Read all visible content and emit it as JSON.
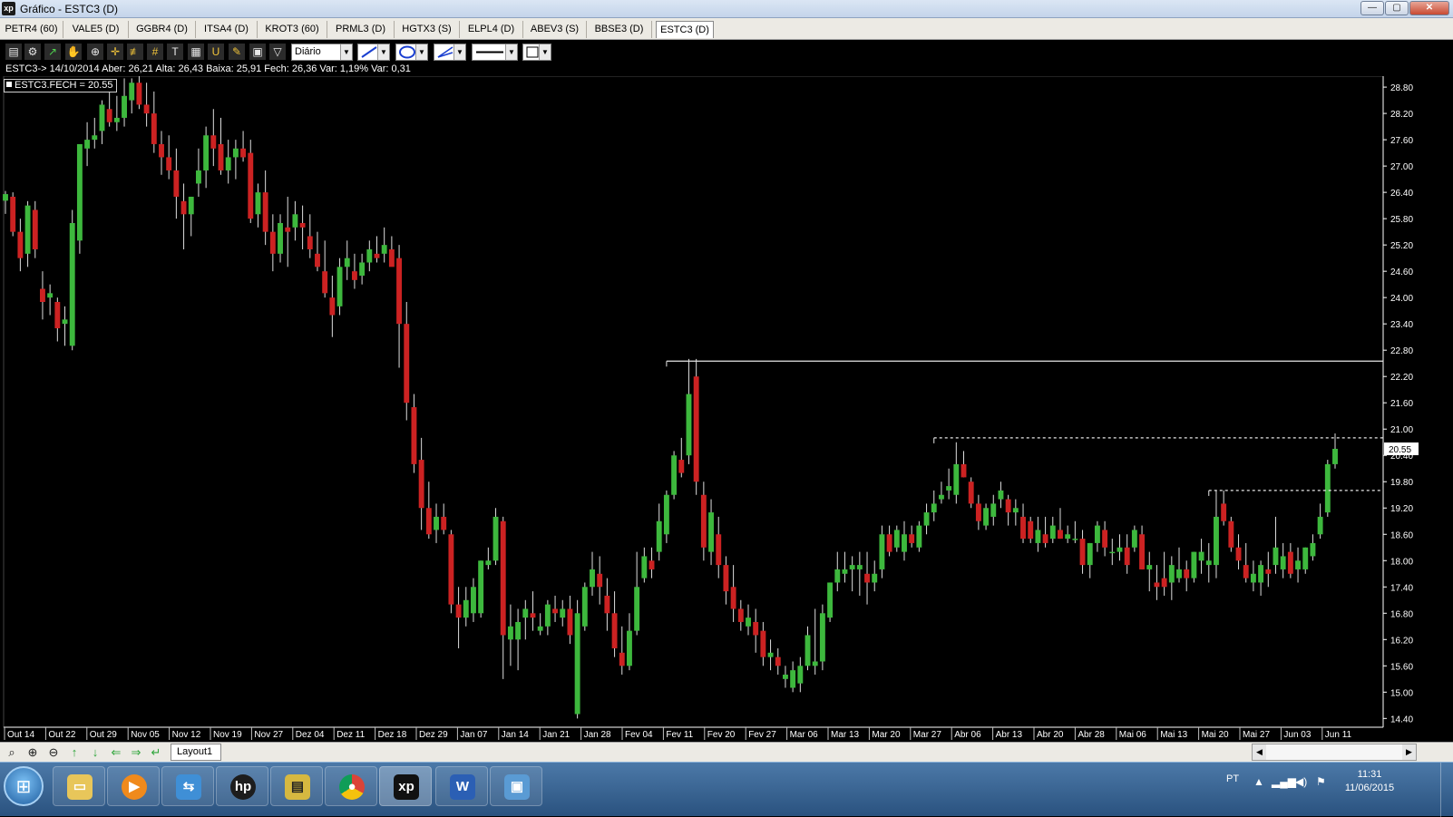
{
  "window": {
    "title": "Gráfico - ESTC3 (D)",
    "icon": "xp-logo-icon",
    "min_label": "—",
    "max_label": "▢",
    "close_label": "✕"
  },
  "tabs": [
    "PETR4 (60)",
    "VALE5 (D)",
    "GGBR4 (D)",
    "ITSA4 (D)",
    "KROT3 (60)",
    "PRML3 (D)",
    "HGTX3 (S)",
    "ELPL4 (D)",
    "ABEV3 (S)",
    "BBSE3 (D)",
    "ESTC3 (D)"
  ],
  "active_tab": "ESTC3 (D)",
  "toolbar": {
    "icons": [
      "chart-type-icon",
      "gear-icon",
      "trend-icon",
      "hand-icon",
      "zoom-chart-icon",
      "crosshair-icon",
      "fibonacci-icon",
      "grid-icon",
      "text-tool-icon",
      "calculator-icon",
      "magnet-icon",
      "eraser-icon",
      "lock-icon",
      "filter-icon"
    ],
    "period": "Diário",
    "line_tool": "line-tool-icon",
    "shape_tool": "ellipse-tool-icon",
    "channel_tool": "channel-tool-icon"
  },
  "info": {
    "line": "ESTC3-> 14/10/2014 Aber: 26,21 Alta: 26,43 Baixa: 25,91 Fech: 26,36 Var: 1,19% Var: 0,31",
    "legend": "ESTC3.FECH = 20.55"
  },
  "colors": {
    "up": "#3db83d",
    "down": "#cc2222",
    "wick": "#dddddd",
    "axis": "#ffffff",
    "background": "#000000"
  },
  "chart_data": {
    "type": "candlestick",
    "symbol": "ESTC3",
    "period": "Diário",
    "ylim": [
      14.2,
      29.05
    ],
    "y_ticks": [
      14.4,
      15.0,
      15.6,
      16.2,
      16.8,
      17.4,
      18.0,
      18.6,
      19.2,
      19.8,
      20.4,
      21.0,
      21.6,
      22.2,
      22.8,
      23.4,
      24.0,
      24.6,
      25.2,
      25.8,
      26.4,
      27.0,
      27.6,
      28.2,
      28.8
    ],
    "x_labels": [
      "Out 14",
      "Out 22",
      "Out 29",
      "Nov 05",
      "Nov 12",
      "Nov 19",
      "Nov 27",
      "Dez 04",
      "Dez 11",
      "Dez 18",
      "Dez 29",
      "Jan 07",
      "Jan 14",
      "Jan 21",
      "Jan 28",
      "Fev 04",
      "Fev 11",
      "Fev 20",
      "Fev 27",
      "Mar 06",
      "Mar 13",
      "Mar 20",
      "Mar 27",
      "Abr 06",
      "Abr 13",
      "Abr 20",
      "Abr 28",
      "Mai 06",
      "Mai 13",
      "Mai 20",
      "Mai 27",
      "Jun 03",
      "Jun 11"
    ],
    "last_price": 20.55,
    "ohlc": [
      [
        26.21,
        26.43,
        25.91,
        26.36
      ],
      [
        26.3,
        26.4,
        25.4,
        25.5
      ],
      [
        25.5,
        25.8,
        24.6,
        24.9
      ],
      [
        25.0,
        26.2,
        24.7,
        26.1
      ],
      [
        26.0,
        26.2,
        24.9,
        25.1
      ],
      [
        24.2,
        24.6,
        23.5,
        23.9
      ],
      [
        24.0,
        24.3,
        23.6,
        24.1
      ],
      [
        23.9,
        24.0,
        23.0,
        23.3
      ],
      [
        23.4,
        23.8,
        22.9,
        23.5
      ],
      [
        22.9,
        26.0,
        22.8,
        25.7
      ],
      [
        25.3,
        26.8,
        25.0,
        27.5
      ],
      [
        27.4,
        28.0,
        27.0,
        27.6
      ],
      [
        27.6,
        28.1,
        27.4,
        27.7
      ],
      [
        27.8,
        28.5,
        27.5,
        28.4
      ],
      [
        28.3,
        28.7,
        27.9,
        28.0
      ],
      [
        28.0,
        28.6,
        27.8,
        28.1
      ],
      [
        28.1,
        29.0,
        27.9,
        28.6
      ],
      [
        28.5,
        29.0,
        28.2,
        28.9
      ],
      [
        28.9,
        29.05,
        28.3,
        28.4
      ],
      [
        28.4,
        28.9,
        27.9,
        28.2
      ],
      [
        28.2,
        28.7,
        27.3,
        27.5
      ],
      [
        27.5,
        27.8,
        26.8,
        27.2
      ],
      [
        27.2,
        27.7,
        26.7,
        26.9
      ],
      [
        26.9,
        27.4,
        25.8,
        26.3
      ],
      [
        26.2,
        26.6,
        25.1,
        25.9
      ],
      [
        25.9,
        26.3,
        25.4,
        26.3
      ],
      [
        26.6,
        27.4,
        26.3,
        26.9
      ],
      [
        26.9,
        27.9,
        26.5,
        27.7
      ],
      [
        27.7,
        28.3,
        27.0,
        27.4
      ],
      [
        27.5,
        28.1,
        26.8,
        26.9
      ],
      [
        26.9,
        27.6,
        26.6,
        27.2
      ],
      [
        27.2,
        27.6,
        26.7,
        27.4
      ],
      [
        27.4,
        27.8,
        27.1,
        27.2
      ],
      [
        27.3,
        27.6,
        25.7,
        25.8
      ],
      [
        25.9,
        26.6,
        25.6,
        26.4
      ],
      [
        26.4,
        26.9,
        25.2,
        25.5
      ],
      [
        25.5,
        25.9,
        24.6,
        25.0
      ],
      [
        25.0,
        25.9,
        24.8,
        25.7
      ],
      [
        25.6,
        26.3,
        24.7,
        25.5
      ],
      [
        25.6,
        26.2,
        25.3,
        25.9
      ],
      [
        25.7,
        26.1,
        25.1,
        25.6
      ],
      [
        25.4,
        25.9,
        24.9,
        25.1
      ],
      [
        25.0,
        25.5,
        24.6,
        24.7
      ],
      [
        24.6,
        25.3,
        24.0,
        24.1
      ],
      [
        24.0,
        24.5,
        23.1,
        23.6
      ],
      [
        23.8,
        24.9,
        23.6,
        24.7
      ],
      [
        24.7,
        25.3,
        24.4,
        24.9
      ],
      [
        24.6,
        25.0,
        24.2,
        24.4
      ],
      [
        24.5,
        25.0,
        24.3,
        24.8
      ],
      [
        24.8,
        25.3,
        24.6,
        25.1
      ],
      [
        25.0,
        25.4,
        24.8,
        24.9
      ],
      [
        25.0,
        25.6,
        24.8,
        25.2
      ],
      [
        25.1,
        25.4,
        24.8,
        24.7
      ],
      [
        24.9,
        25.2,
        22.4,
        23.4
      ],
      [
        23.4,
        23.9,
        21.2,
        21.6
      ],
      [
        21.5,
        21.8,
        20.0,
        20.2
      ],
      [
        20.3,
        20.8,
        18.7,
        19.2
      ],
      [
        19.2,
        19.8,
        18.5,
        18.6
      ],
      [
        18.7,
        19.3,
        18.4,
        19.0
      ],
      [
        19.0,
        19.3,
        18.6,
        18.7
      ],
      [
        18.6,
        18.7,
        16.8,
        17.0
      ],
      [
        17.0,
        17.4,
        16.0,
        16.7
      ],
      [
        16.7,
        17.4,
        16.5,
        17.1
      ],
      [
        16.8,
        17.6,
        16.6,
        17.4
      ],
      [
        16.8,
        18.0,
        16.7,
        18.0
      ],
      [
        17.9,
        18.3,
        17.8,
        18.0
      ],
      [
        18.0,
        19.2,
        17.9,
        19.0
      ],
      [
        18.9,
        19.0,
        15.3,
        16.3
      ],
      [
        16.2,
        17.0,
        15.6,
        16.5
      ],
      [
        16.2,
        16.9,
        15.5,
        16.6
      ],
      [
        16.7,
        17.1,
        16.2,
        16.9
      ],
      [
        16.8,
        17.3,
        16.4,
        16.7
      ],
      [
        16.4,
        16.8,
        16.3,
        16.5
      ],
      [
        16.5,
        17.1,
        16.3,
        17.0
      ],
      [
        16.9,
        17.2,
        16.6,
        16.8
      ],
      [
        16.7,
        17.1,
        16.5,
        16.9
      ],
      [
        16.9,
        17.2,
        16.1,
        16.3
      ],
      [
        14.5,
        17.1,
        14.4,
        16.8
      ],
      [
        16.5,
        17.5,
        16.4,
        17.4
      ],
      [
        17.4,
        18.2,
        17.2,
        17.8
      ],
      [
        17.7,
        18.1,
        17.0,
        17.4
      ],
      [
        17.2,
        17.6,
        16.4,
        16.8
      ],
      [
        16.8,
        17.3,
        15.8,
        16.0
      ],
      [
        15.9,
        16.5,
        15.4,
        15.6
      ],
      [
        15.6,
        16.8,
        15.5,
        16.4
      ],
      [
        16.4,
        18.2,
        16.3,
        17.4
      ],
      [
        17.6,
        18.3,
        17.5,
        18.1
      ],
      [
        18.0,
        18.3,
        17.6,
        17.8
      ],
      [
        18.2,
        19.3,
        18.0,
        18.9
      ],
      [
        18.6,
        19.6,
        18.4,
        19.5
      ],
      [
        19.5,
        20.5,
        19.4,
        20.4
      ],
      [
        20.3,
        20.8,
        19.9,
        20.0
      ],
      [
        20.4,
        22.6,
        20.2,
        21.8
      ],
      [
        22.2,
        22.6,
        19.5,
        19.8
      ],
      [
        19.5,
        19.8,
        18.0,
        18.3
      ],
      [
        18.2,
        19.4,
        17.9,
        19.1
      ],
      [
        18.6,
        19.0,
        17.6,
        17.9
      ],
      [
        17.9,
        18.1,
        17.0,
        17.3
      ],
      [
        17.4,
        17.9,
        16.6,
        16.9
      ],
      [
        16.9,
        17.1,
        16.4,
        16.6
      ],
      [
        16.5,
        17.0,
        16.3,
        16.7
      ],
      [
        16.6,
        16.9,
        15.9,
        16.3
      ],
      [
        16.4,
        16.6,
        15.6,
        15.8
      ],
      [
        15.8,
        16.2,
        15.5,
        15.9
      ],
      [
        15.8,
        16.0,
        15.4,
        15.6
      ],
      [
        15.3,
        15.6,
        15.1,
        15.4
      ],
      [
        15.1,
        15.7,
        15.0,
        15.5
      ],
      [
        15.2,
        15.8,
        15.0,
        15.6
      ],
      [
        15.6,
        16.5,
        15.5,
        16.3
      ],
      [
        15.6,
        16.9,
        15.4,
        15.7
      ],
      [
        15.7,
        17.0,
        15.5,
        16.8
      ],
      [
        16.7,
        17.5,
        16.6,
        17.5
      ],
      [
        17.5,
        18.2,
        17.3,
        17.8
      ],
      [
        17.7,
        18.2,
        17.5,
        17.8
      ],
      [
        17.8,
        18.1,
        17.3,
        17.9
      ],
      [
        17.8,
        18.2,
        17.2,
        17.9
      ],
      [
        17.7,
        18.2,
        17.0,
        17.5
      ],
      [
        17.5,
        18.0,
        17.3,
        17.7
      ],
      [
        17.8,
        18.8,
        17.6,
        18.6
      ],
      [
        18.6,
        18.8,
        18.1,
        18.2
      ],
      [
        18.3,
        18.8,
        18.2,
        18.7
      ],
      [
        18.2,
        18.9,
        18.0,
        18.6
      ],
      [
        18.6,
        18.8,
        18.3,
        18.4
      ],
      [
        18.3,
        18.9,
        18.2,
        18.8
      ],
      [
        18.8,
        19.3,
        18.6,
        19.1
      ],
      [
        19.1,
        19.6,
        18.9,
        19.3
      ],
      [
        19.4,
        19.8,
        19.3,
        19.5
      ],
      [
        19.6,
        20.1,
        19.4,
        19.7
      ],
      [
        19.5,
        20.7,
        19.3,
        20.2
      ],
      [
        20.2,
        20.5,
        19.9,
        19.9
      ],
      [
        19.8,
        19.9,
        19.2,
        19.3
      ],
      [
        19.3,
        19.5,
        18.7,
        18.9
      ],
      [
        18.8,
        19.3,
        18.7,
        19.2
      ],
      [
        19.0,
        19.5,
        18.8,
        19.3
      ],
      [
        19.4,
        19.8,
        19.2,
        19.6
      ],
      [
        19.4,
        19.5,
        18.8,
        19.1
      ],
      [
        19.1,
        19.4,
        18.8,
        19.2
      ],
      [
        19.0,
        19.3,
        18.4,
        18.5
      ],
      [
        18.9,
        19.0,
        18.4,
        18.5
      ],
      [
        18.4,
        19.0,
        18.2,
        18.7
      ],
      [
        18.6,
        19.0,
        18.3,
        18.4
      ],
      [
        18.5,
        19.0,
        18.4,
        18.8
      ],
      [
        18.7,
        19.2,
        18.5,
        18.5
      ],
      [
        18.5,
        18.8,
        18.4,
        18.6
      ],
      [
        18.5,
        18.9,
        18.4,
        18.5
      ],
      [
        18.5,
        18.7,
        17.7,
        17.9
      ],
      [
        17.9,
        18.4,
        17.6,
        18.4
      ],
      [
        18.4,
        18.9,
        18.2,
        18.8
      ],
      [
        18.7,
        18.9,
        18.1,
        18.3
      ],
      [
        18.2,
        18.5,
        17.9,
        18.2
      ],
      [
        18.2,
        18.6,
        18.0,
        18.3
      ],
      [
        18.3,
        18.6,
        17.7,
        17.9
      ],
      [
        18.3,
        18.8,
        18.2,
        18.7
      ],
      [
        18.6,
        18.8,
        17.8,
        17.8
      ],
      [
        17.8,
        18.2,
        17.3,
        17.9
      ],
      [
        17.5,
        17.9,
        17.1,
        17.4
      ],
      [
        17.6,
        18.2,
        17.2,
        17.4
      ],
      [
        17.5,
        18.1,
        17.1,
        17.9
      ],
      [
        17.6,
        18.3,
        17.5,
        17.8
      ],
      [
        17.8,
        18.0,
        17.3,
        17.6
      ],
      [
        17.6,
        18.2,
        17.5,
        18.2
      ],
      [
        18.0,
        18.5,
        17.7,
        18.2
      ],
      [
        17.9,
        18.4,
        17.5,
        18.0
      ],
      [
        17.9,
        19.6,
        17.6,
        19.0
      ],
      [
        19.3,
        19.6,
        18.8,
        18.9
      ],
      [
        18.9,
        19.0,
        18.2,
        18.3
      ],
      [
        18.3,
        18.6,
        17.8,
        18.0
      ],
      [
        17.9,
        18.4,
        17.5,
        17.6
      ],
      [
        17.5,
        18.0,
        17.3,
        17.7
      ],
      [
        17.5,
        18.0,
        17.2,
        17.9
      ],
      [
        17.8,
        18.2,
        17.4,
        17.7
      ],
      [
        17.9,
        19.0,
        17.7,
        18.3
      ],
      [
        17.8,
        18.4,
        17.6,
        18.1
      ],
      [
        18.2,
        18.4,
        17.6,
        17.7
      ],
      [
        17.8,
        18.3,
        17.5,
        18.0
      ],
      [
        17.8,
        18.3,
        17.7,
        18.3
      ],
      [
        18.1,
        18.6,
        18.0,
        18.4
      ],
      [
        18.6,
        19.3,
        18.5,
        19.0
      ],
      [
        19.1,
        20.3,
        19.0,
        20.2
      ],
      [
        20.2,
        20.9,
        20.1,
        20.55
      ]
    ],
    "lines": [
      {
        "kind": "solid",
        "y": 22.55,
        "from_index": 89
      },
      {
        "kind": "dashed",
        "y": 20.8,
        "from_index": 125
      },
      {
        "kind": "dashed",
        "y": 19.6,
        "from_index": 162
      }
    ]
  },
  "bottom": {
    "nav_icons": [
      "zoom-reset-icon",
      "zoom-in-icon",
      "zoom-out-icon",
      "arrow-up-icon",
      "arrow-down-icon",
      "arrow-left-icon",
      "arrow-right-icon",
      "arrow-back-icon"
    ],
    "layout_tab": "Layout1"
  },
  "taskbar": {
    "apps": [
      "file-explorer-icon",
      "media-player-icon",
      "network-icon",
      "hp-icon",
      "archive-icon",
      "chrome-icon",
      "xp-app-icon",
      "word-icon",
      "picture-viewer-icon"
    ],
    "xp_label": "xp",
    "word_label": "W",
    "hp_label": "hp",
    "language": "PT",
    "time": "11:31",
    "date": "11/06/2015"
  }
}
